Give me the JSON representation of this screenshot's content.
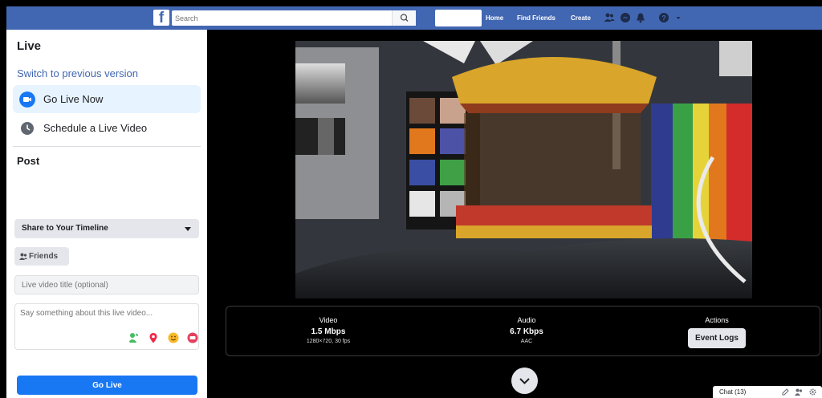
{
  "topbar": {
    "logo": "f",
    "search_placeholder": "Search",
    "nav": [
      "Home",
      "Find Friends",
      "Create"
    ]
  },
  "left": {
    "title": "Live",
    "switch_link": "Switch to previous version",
    "options": [
      "Go Live Now",
      "Schedule a Live Video"
    ],
    "post_title": "Post",
    "share_dropdown": "Share to Your Timeline",
    "audience_button": "Friends",
    "title_placeholder": "Live video title (optional)",
    "description_placeholder": "Say something about this live video...",
    "go_live_button": "Go Live"
  },
  "stats": {
    "video": {
      "label": "Video",
      "value": "1.5 Mbps",
      "sub": "1280×720, 30 fps"
    },
    "audio": {
      "label": "Audio",
      "value": "6.7 Kbps",
      "sub": "AAC"
    },
    "actions": {
      "label": "Actions",
      "button": "Event Logs"
    }
  },
  "chat": {
    "label": "Chat (13)"
  },
  "colors": {
    "brand": "#4267b2",
    "primary_button": "#1877f2"
  },
  "icons": [
    "search-icon",
    "friends-icon",
    "messenger-icon",
    "bell-icon",
    "help-icon",
    "chevron-down-icon",
    "live-icon",
    "clock-icon",
    "tag-friends-icon",
    "location-icon",
    "feeling-icon",
    "sticker-icon",
    "compose-icon",
    "settings-icon"
  ]
}
